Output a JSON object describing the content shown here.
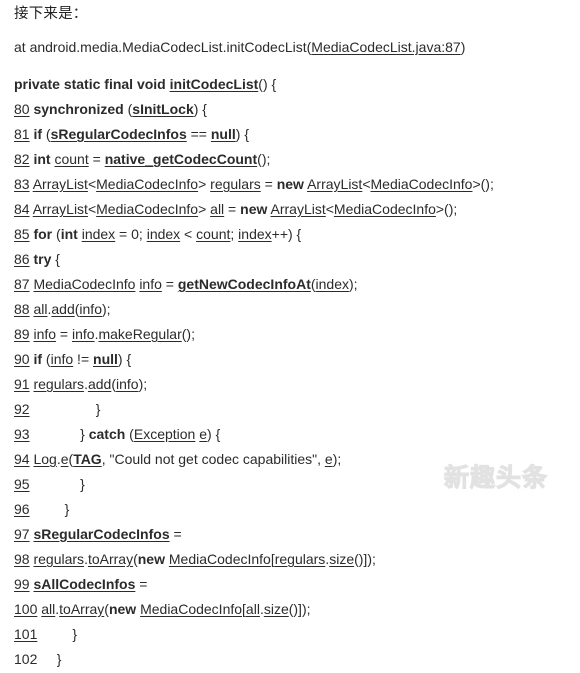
{
  "intro": {
    "text": "接下来是："
  },
  "stack_trace": {
    "prefix": "at android.media.MediaCodecList.initCodecList(",
    "link": "MediaCodecList.java:87",
    "suffix": ")"
  },
  "watermark": {
    "text": "新趣头条"
  },
  "code": {
    "language": "java",
    "signature": {
      "number": "",
      "text": "private static final void initCodecList() {"
    },
    "lines": [
      {
        "number": "80",
        "number_underlined": true,
        "text": "synchronized (sInitLock) {"
      },
      {
        "number": "81",
        "number_underlined": true,
        "text": "if (sRegularCodecInfos == null) {"
      },
      {
        "number": "82",
        "number_underlined": true,
        "text": "int count = native_getCodecCount();"
      },
      {
        "number": "83",
        "number_underlined": true,
        "text": "ArrayList<MediaCodecInfo> regulars = new ArrayList<MediaCodecInfo>();"
      },
      {
        "number": "84",
        "number_underlined": true,
        "text": "ArrayList<MediaCodecInfo> all = new ArrayList<MediaCodecInfo>();"
      },
      {
        "number": "85",
        "number_underlined": true,
        "text": "for (int index = 0; index < count; index++) {"
      },
      {
        "number": "86",
        "number_underlined": true,
        "text": "try {"
      },
      {
        "number": "87",
        "number_underlined": true,
        "text": "MediaCodecInfo info = getNewCodecInfoAt(index);"
      },
      {
        "number": "88",
        "number_underlined": true,
        "text": "all.add(info);"
      },
      {
        "number": "89",
        "number_underlined": true,
        "text": "info = info.makeRegular();"
      },
      {
        "number": "90",
        "number_underlined": true,
        "text": "if (info != null) {"
      },
      {
        "number": "91",
        "number_underlined": true,
        "text": "regulars.add(info);"
      },
      {
        "number": "92",
        "number_underlined": true,
        "text": "                }"
      },
      {
        "number": "93",
        "number_underlined": true,
        "text": "            } catch (Exception e) {"
      },
      {
        "number": "94",
        "number_underlined": true,
        "text": "Log.e(TAG, \"Could not get codec capabilities\", e);"
      },
      {
        "number": "95",
        "number_underlined": true,
        "text": "            }"
      },
      {
        "number": "96",
        "number_underlined": true,
        "text": "        }"
      },
      {
        "number": "97",
        "number_underlined": true,
        "text": "sRegularCodecInfos ="
      },
      {
        "number": "98",
        "number_underlined": true,
        "text": "regulars.toArray(new MediaCodecInfo[regulars.size()]);"
      },
      {
        "number": "99",
        "number_underlined": true,
        "text": "sAllCodecInfos ="
      },
      {
        "number": "100",
        "number_underlined": true,
        "text": "all.toArray(new MediaCodecInfo[all.size()]);"
      },
      {
        "number": "101",
        "number_underlined": true,
        "text": "        }"
      },
      {
        "number": "102",
        "number_underlined": false,
        "text": "    }"
      }
    ]
  }
}
